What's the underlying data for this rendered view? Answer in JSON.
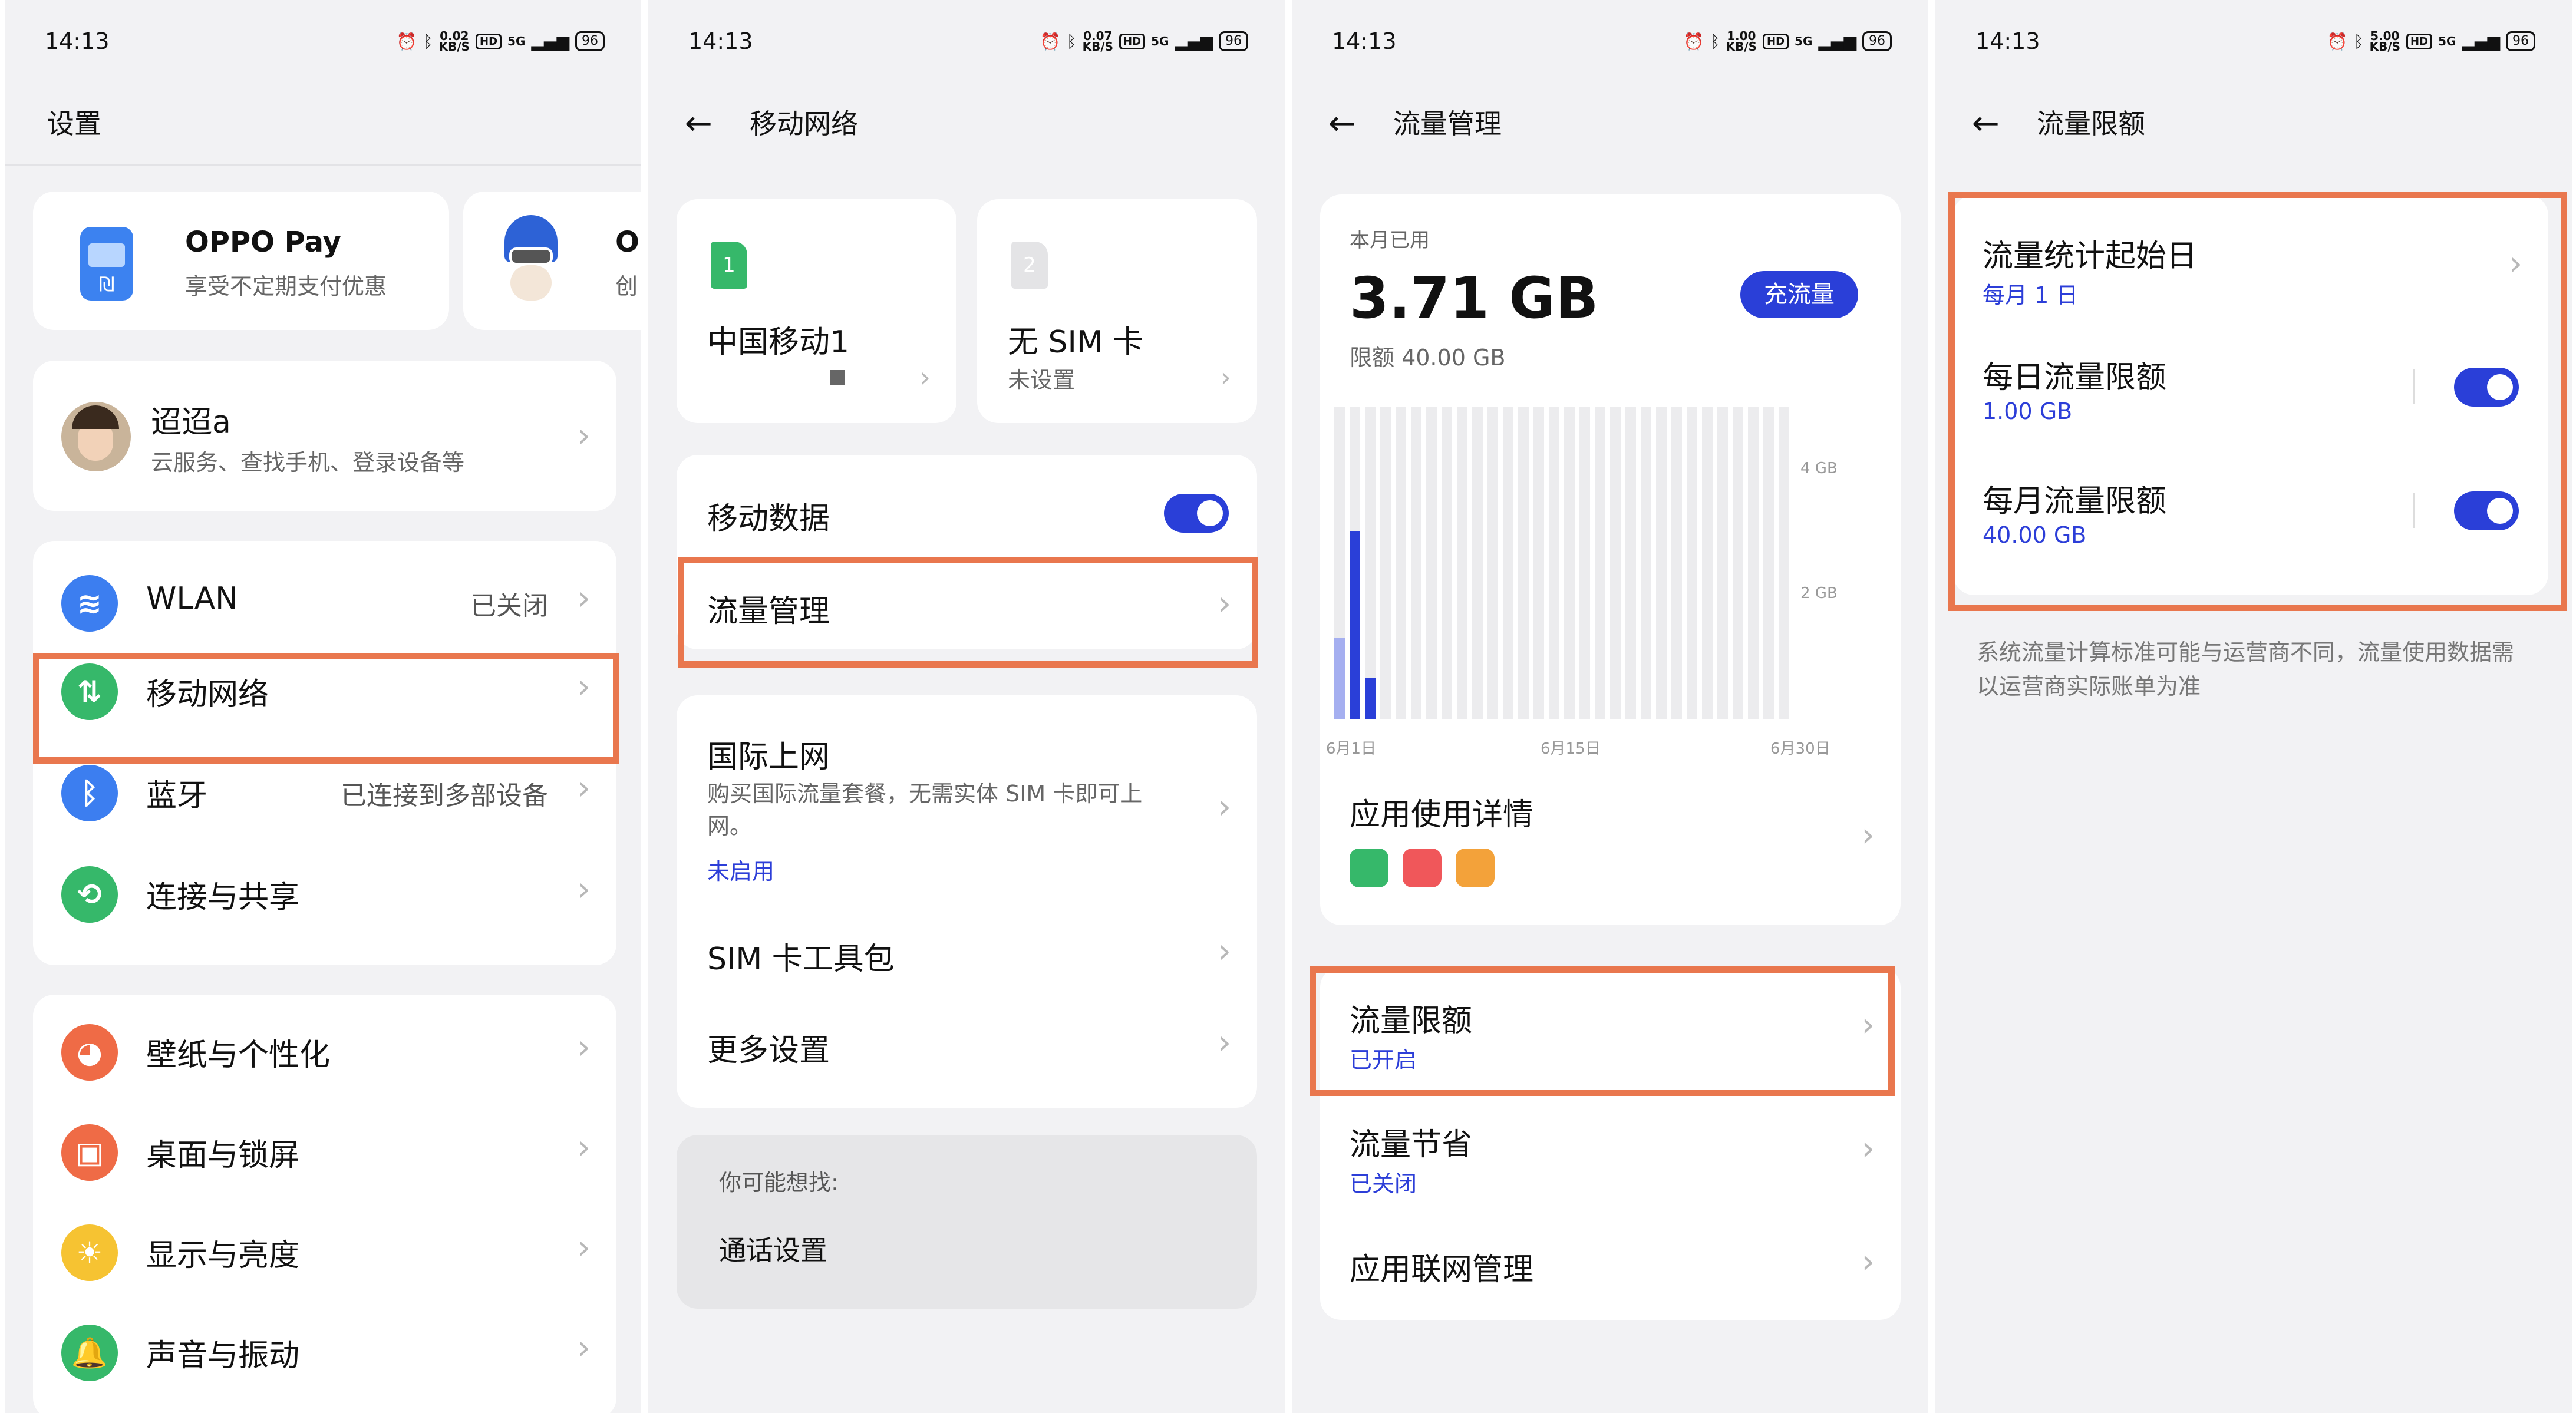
{
  "status_bars": [
    {
      "time": "14:13",
      "speed_top": "0.02",
      "speed_unit": "KB/S",
      "hd": "HD",
      "net": "5G",
      "battery": "96"
    },
    {
      "time": "14:13",
      "speed_top": "0.07",
      "speed_unit": "KB/S",
      "hd": "HD",
      "net": "5G",
      "battery": "96"
    },
    {
      "time": "14:13",
      "speed_top": "1.00",
      "speed_unit": "KB/S",
      "hd": "HD",
      "net": "5G",
      "battery": "96"
    },
    {
      "time": "14:13",
      "speed_top": "5.00",
      "speed_unit": "KB/S",
      "hd": "HD",
      "net": "5G",
      "battery": "96"
    }
  ],
  "screen1": {
    "title": "设置",
    "oppo_pay": {
      "title": "OPPO Pay",
      "subtitle": "享受不定期支付优惠"
    },
    "second_promo": {
      "title": "Or",
      "subtitle": "创"
    },
    "account": {
      "name": "迢迢a",
      "subtitle": "云服务、查找手机、登录设备等"
    },
    "net_items": [
      {
        "label": "WLAN",
        "value": "已关闭",
        "icon": "wifi-icon"
      },
      {
        "label": "移动网络",
        "value": "",
        "icon": "mobile-data-icon"
      },
      {
        "label": "蓝牙",
        "value": "已连接到多部设备",
        "icon": "bluetooth-icon"
      },
      {
        "label": "连接与共享",
        "value": "",
        "icon": "share-icon"
      }
    ],
    "display_items": [
      {
        "label": "壁纸与个性化",
        "icon": "palette-icon"
      },
      {
        "label": "桌面与锁屏",
        "icon": "picture-icon"
      },
      {
        "label": "显示与亮度",
        "icon": "sun-icon"
      },
      {
        "label": "声音与振动",
        "icon": "bell-icon"
      }
    ]
  },
  "screen2": {
    "title": "移动网络",
    "sim1": {
      "badge": "1",
      "name": "中国移动1"
    },
    "sim2": {
      "badge": "2",
      "name": "无 SIM 卡",
      "status": "未设置"
    },
    "mobile_data": {
      "label": "移动数据",
      "enabled": true
    },
    "traffic_mgmt": "流量管理",
    "intl": {
      "label": "国际上网",
      "desc": "购买国际流量套餐，无需实体 SIM 卡即可上网。",
      "status": "未启用"
    },
    "sim_toolkit": "SIM 卡工具包",
    "more_settings": "更多设置",
    "suggest": {
      "header": "你可能想找:",
      "item": "通话设置"
    }
  },
  "screen3": {
    "title": "流量管理",
    "usage": {
      "label": "本月已用",
      "value": "3.71 GB",
      "limit": "限额 40.00 GB",
      "recharge": "充流量"
    },
    "chart_data": {
      "type": "bar",
      "ylim": [
        0,
        5
      ],
      "y_ticks": [
        "4 GB",
        "2 GB"
      ],
      "x_ticks": [
        "6月1日",
        "6月15日",
        "6月30日"
      ],
      "days": 30,
      "values": [
        1.3,
        3.0,
        0.65,
        0,
        0,
        0,
        0,
        0,
        0,
        0,
        0,
        0,
        0,
        0,
        0,
        0,
        0,
        0,
        0,
        0,
        0,
        0,
        0,
        0,
        0,
        0,
        0,
        0,
        0,
        0
      ]
    },
    "app_detail": "应用使用详情",
    "limit": {
      "label": "流量限额",
      "status": "已开启"
    },
    "saver": {
      "label": "流量节省",
      "status": "已关闭"
    },
    "net_mgmt": "应用联网管理"
  },
  "screen4": {
    "title": "流量限额",
    "start": {
      "label": "流量统计起始日",
      "value": "每月 1 日"
    },
    "daily": {
      "label": "每日流量限额",
      "value": "1.00 GB",
      "enabled": true
    },
    "monthly": {
      "label": "每月流量限额",
      "value": "40.00 GB",
      "enabled": true
    },
    "note": "系统流量计算标准可能与运营商不同，流量使用数据需以运营商实际账单为准"
  }
}
